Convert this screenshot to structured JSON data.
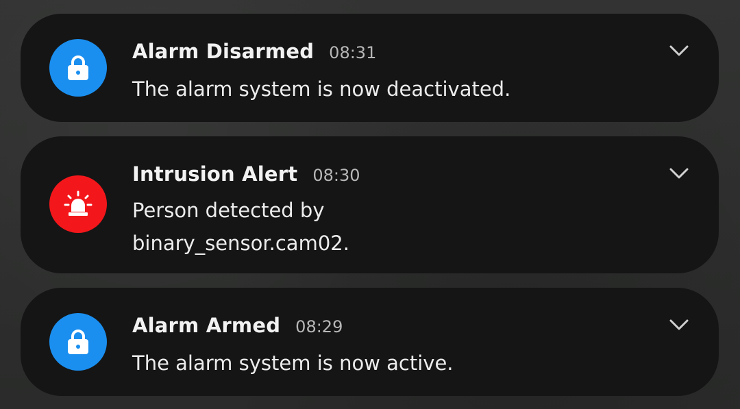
{
  "notifications": [
    {
      "title": "Alarm Disarmed",
      "time": "08:31",
      "message": "The alarm system is now deactivated.",
      "icon": "lock-icon",
      "icon_color": "#1a8ff0"
    },
    {
      "title": "Intrusion Alert",
      "time": "08:30",
      "message": "Person detected by binary_sensor.cam02.",
      "icon": "alarm-siren-icon",
      "icon_color": "#f3171b"
    },
    {
      "title": "Alarm Armed",
      "time": "08:29",
      "message": "The alarm system is now active.",
      "icon": "lock-icon",
      "icon_color": "#1a8ff0"
    }
  ],
  "colors": {
    "card_background": "#151515",
    "page_background": "#2e2f2e",
    "title_text": "#f2f2f2",
    "time_text": "#b7b7b7"
  }
}
